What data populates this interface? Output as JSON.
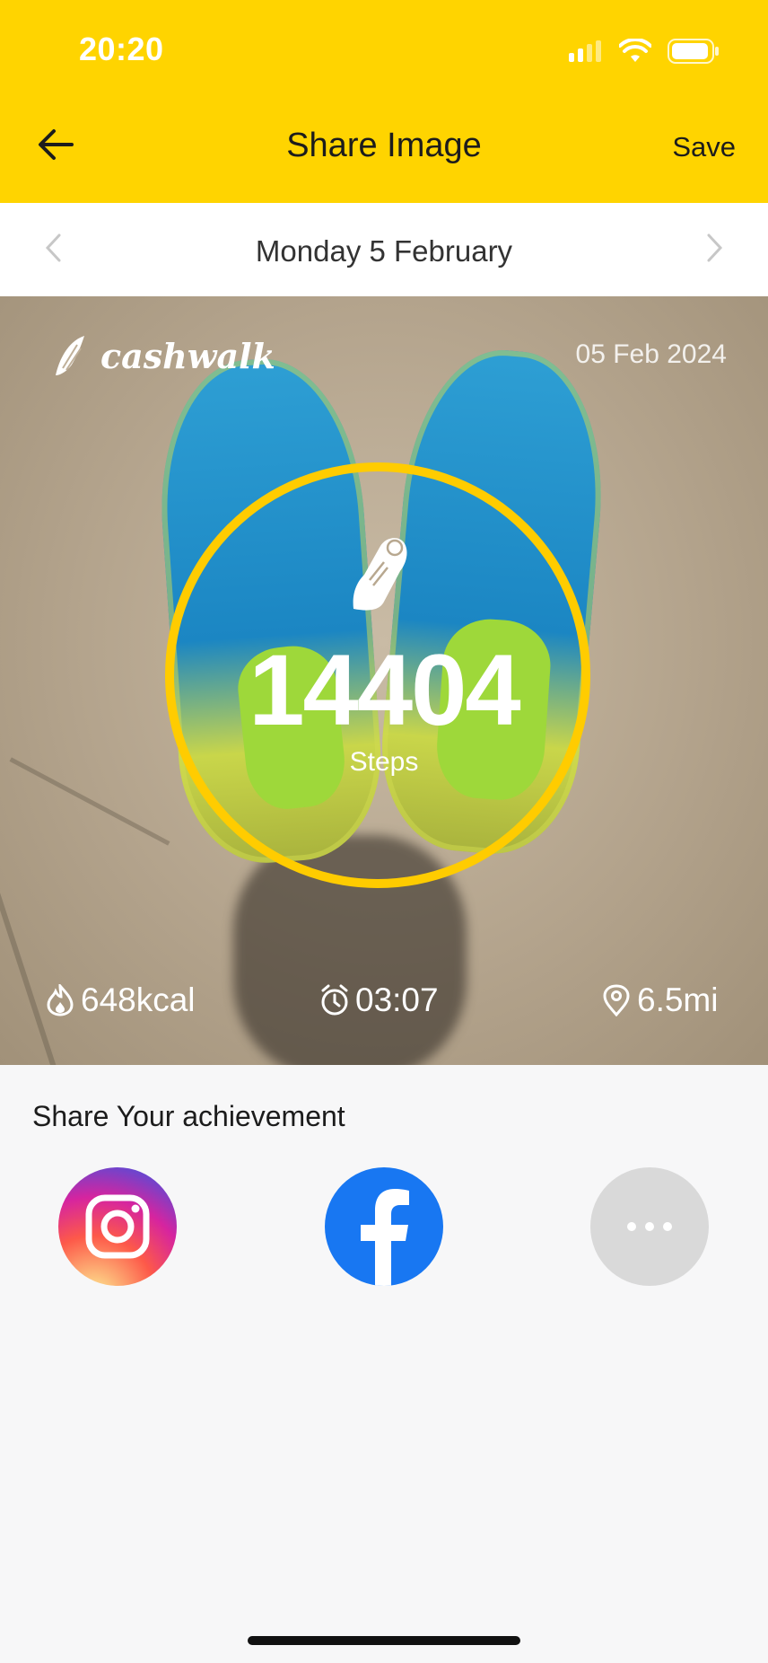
{
  "status_bar": {
    "time": "20:20"
  },
  "header": {
    "title": "Share Image",
    "save_label": "Save"
  },
  "date_nav": {
    "label": "Monday 5 February"
  },
  "card": {
    "brand": "cashwalk",
    "date": "05 Feb 2024",
    "steps": "14404",
    "steps_label": "Steps",
    "calories": "648kcal",
    "duration": "03:07",
    "distance": "6.5mi"
  },
  "share": {
    "title": "Share Your achievement",
    "icons": [
      "instagram-icon",
      "facebook-icon",
      "more-icon"
    ]
  },
  "colors": {
    "accent": "#ffd400",
    "ring": "#ffcc00",
    "facebook": "#1877f2",
    "more": "#d9d9d9"
  }
}
